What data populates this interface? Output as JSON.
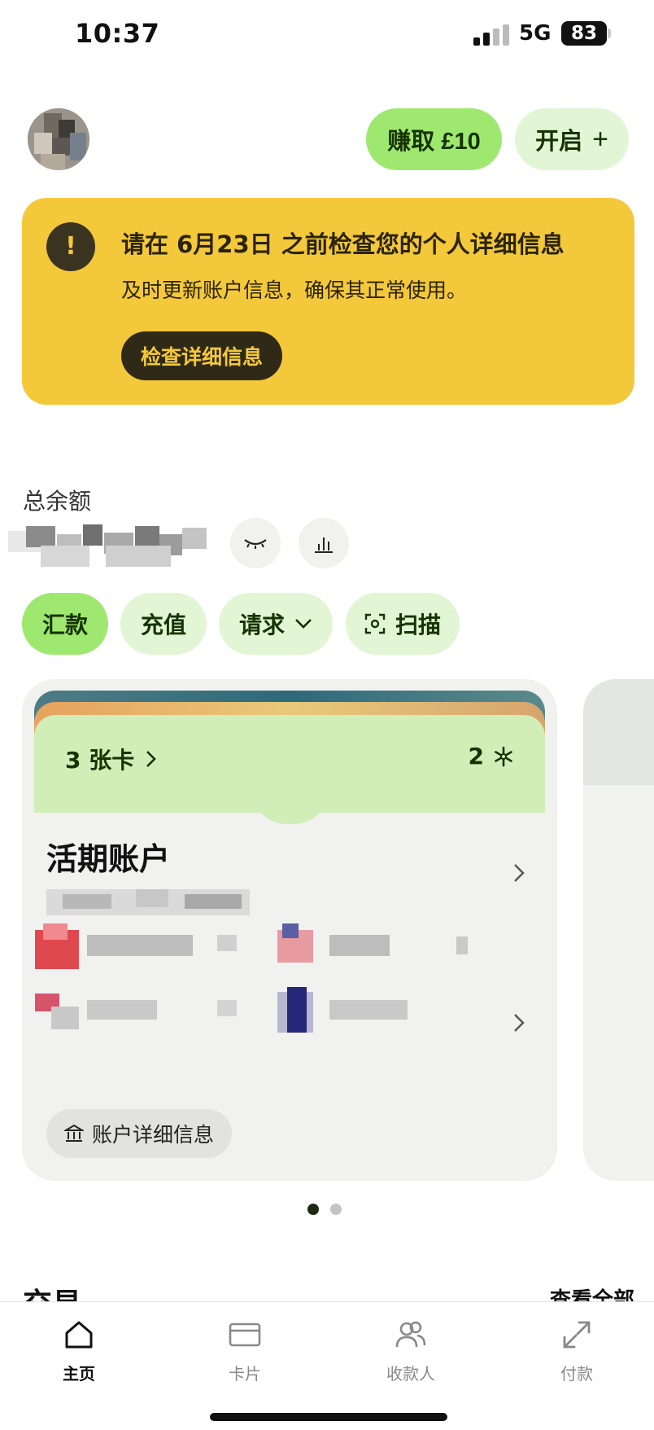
{
  "status_bar": {
    "time": "10:37",
    "network": "5G",
    "battery": "83"
  },
  "header": {
    "earn_label": "赚取 £10",
    "open_label": "开启"
  },
  "alert": {
    "icon": "!",
    "title": "请在 6月23日 之前检查您的个人详细信息",
    "body": "及时更新账户信息，确保其正常使用。",
    "button": "检查详细信息"
  },
  "balance": {
    "label": "总余额"
  },
  "actions": {
    "send": "汇款",
    "topup": "充值",
    "request": "请求",
    "scan": "扫描"
  },
  "account_card": {
    "cards_count": "3 张卡",
    "frozen_count": "2",
    "title": "活期账户",
    "details_button": "账户详细信息"
  },
  "pager": {
    "total": 2,
    "active": 1
  },
  "transactions": {
    "title": "交易",
    "view_all": "查看全部"
  },
  "bottom_nav": {
    "home": "主页",
    "cards": "卡片",
    "recipients": "收款人",
    "pay": "付款"
  },
  "colors": {
    "accent": "#9fe870",
    "accent_soft": "#e2f6d5",
    "alert": "#f4c83b",
    "ink": "#163300"
  },
  "icons": [
    "signal-icon",
    "battery-icon",
    "plus-icon",
    "alert-icon",
    "eye-closed-icon",
    "bar-chart-icon",
    "chevron-down-icon",
    "scan-icon",
    "chevron-right-icon",
    "snowflake-icon",
    "bank-icon",
    "home-icon",
    "card-icon",
    "people-icon",
    "transfer-icon"
  ]
}
